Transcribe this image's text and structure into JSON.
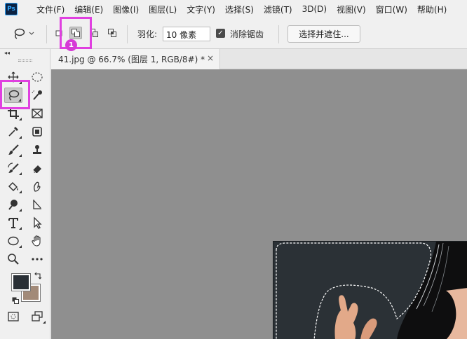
{
  "app": {
    "logo_text": "Ps",
    "brand_color": "#31a8ff"
  },
  "menu": {
    "items": [
      {
        "label": "文件(F)"
      },
      {
        "label": "编辑(E)"
      },
      {
        "label": "图像(I)"
      },
      {
        "label": "图层(L)"
      },
      {
        "label": "文字(Y)"
      },
      {
        "label": "选择(S)"
      },
      {
        "label": "滤镜(T)"
      },
      {
        "label": "3D(D)"
      },
      {
        "label": "视图(V)"
      },
      {
        "label": "窗口(W)"
      },
      {
        "label": "帮助(H)"
      }
    ]
  },
  "options": {
    "tool_preset_icon": "lasso-icon",
    "selection_modes": [
      {
        "name": "new-selection",
        "active": false
      },
      {
        "name": "add-to-selection",
        "active": true
      },
      {
        "name": "subtract-from-selection",
        "active": false
      },
      {
        "name": "intersect-with-selection",
        "active": false
      }
    ],
    "feather_label": "羽化:",
    "feather_value": "10 像素",
    "antialias_label": "消除锯齿",
    "antialias_checked": true,
    "select_and_mask_label": "选择并遮住...",
    "badge_number": "1",
    "highlight_color": "#e040e0"
  },
  "document": {
    "tab_title": "41.jpg @ 66.7% (图层 1, RGB/8#) *",
    "close_glyph": "×"
  },
  "toolbar": {
    "collapse_glyph": "◂◂",
    "tools": [
      "move-icon",
      "marquee-icon",
      "lasso-icon",
      "quick-selection-icon",
      "crop-icon",
      "frame-icon",
      "eyedropper-icon",
      "patch-icon",
      "brush-icon",
      "stamp-icon",
      "history-brush-icon",
      "eraser-icon",
      "paint-bucket-icon",
      "smudge-icon",
      "dodge-icon",
      "path-selection-icon",
      "type-icon",
      "direct-selection-icon",
      "ellipse-icon",
      "hand-icon",
      "zoom-icon",
      "more-icon"
    ],
    "foreground_color": "#2a3036",
    "background_color": "#a28a78"
  },
  "canvas": {
    "background": "#8f8f8f",
    "photo_background": "#2b3136"
  }
}
